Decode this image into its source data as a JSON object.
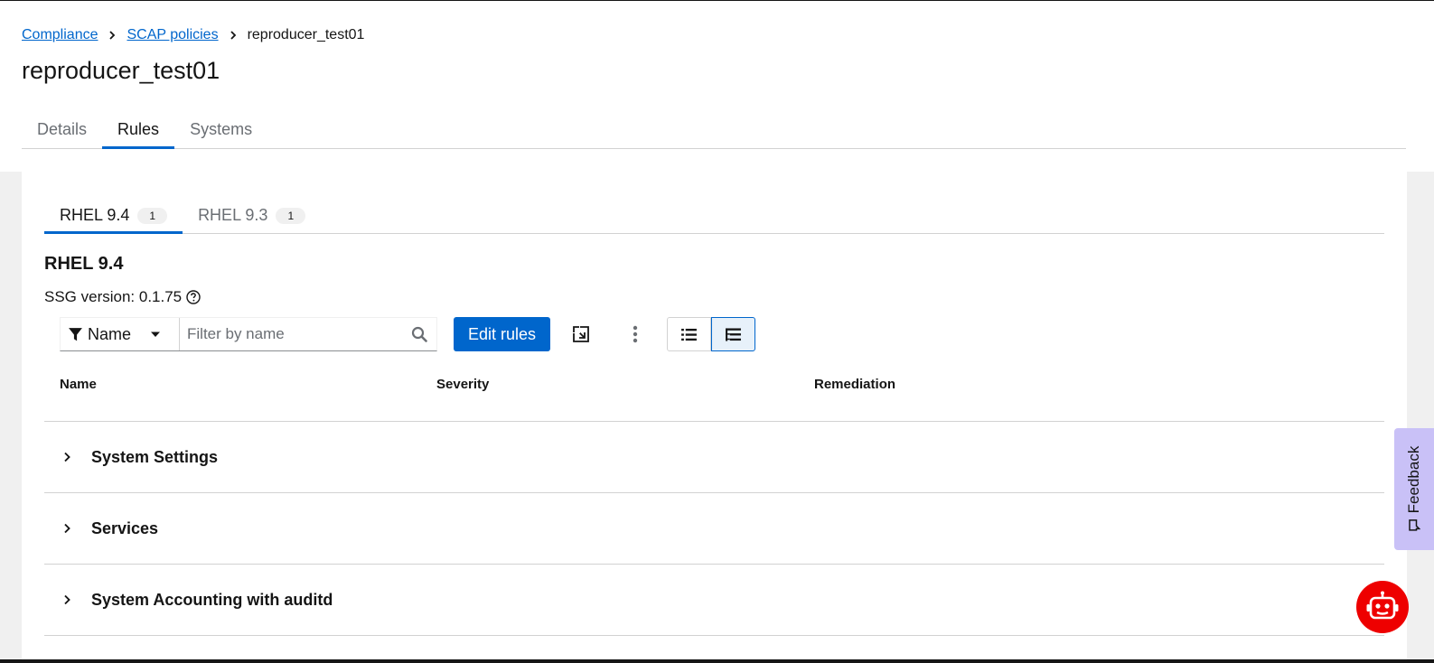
{
  "breadcrumb": {
    "items": [
      {
        "label": "Compliance"
      },
      {
        "label": "SCAP policies"
      },
      {
        "label": "reproducer_test01"
      }
    ]
  },
  "page": {
    "title": "reproducer_test01"
  },
  "main_tabs": [
    {
      "label": "Details",
      "active": false
    },
    {
      "label": "Rules",
      "active": true
    },
    {
      "label": "Systems",
      "active": false
    }
  ],
  "release_tabs": [
    {
      "label": "RHEL 9.4",
      "count": "1",
      "active": true
    },
    {
      "label": "RHEL 9.3",
      "count": "1",
      "active": false
    }
  ],
  "section": {
    "title": "RHEL 9.4",
    "ssg_version": "SSG version: 0.1.75"
  },
  "toolbar": {
    "filter_attribute": "Name",
    "filter_placeholder": "Filter by name",
    "edit_rules_label": "Edit rules"
  },
  "table": {
    "columns": [
      "Name",
      "Severity",
      "Remediation"
    ],
    "groups": [
      {
        "label": "System Settings"
      },
      {
        "label": "Services"
      },
      {
        "label": "System Accounting with auditd"
      }
    ]
  },
  "feedback": {
    "label": "Feedback"
  },
  "colors": {
    "primary": "#0066cc",
    "chatbot": "#ee0000",
    "feedback_bg": "#c9c1f7"
  }
}
